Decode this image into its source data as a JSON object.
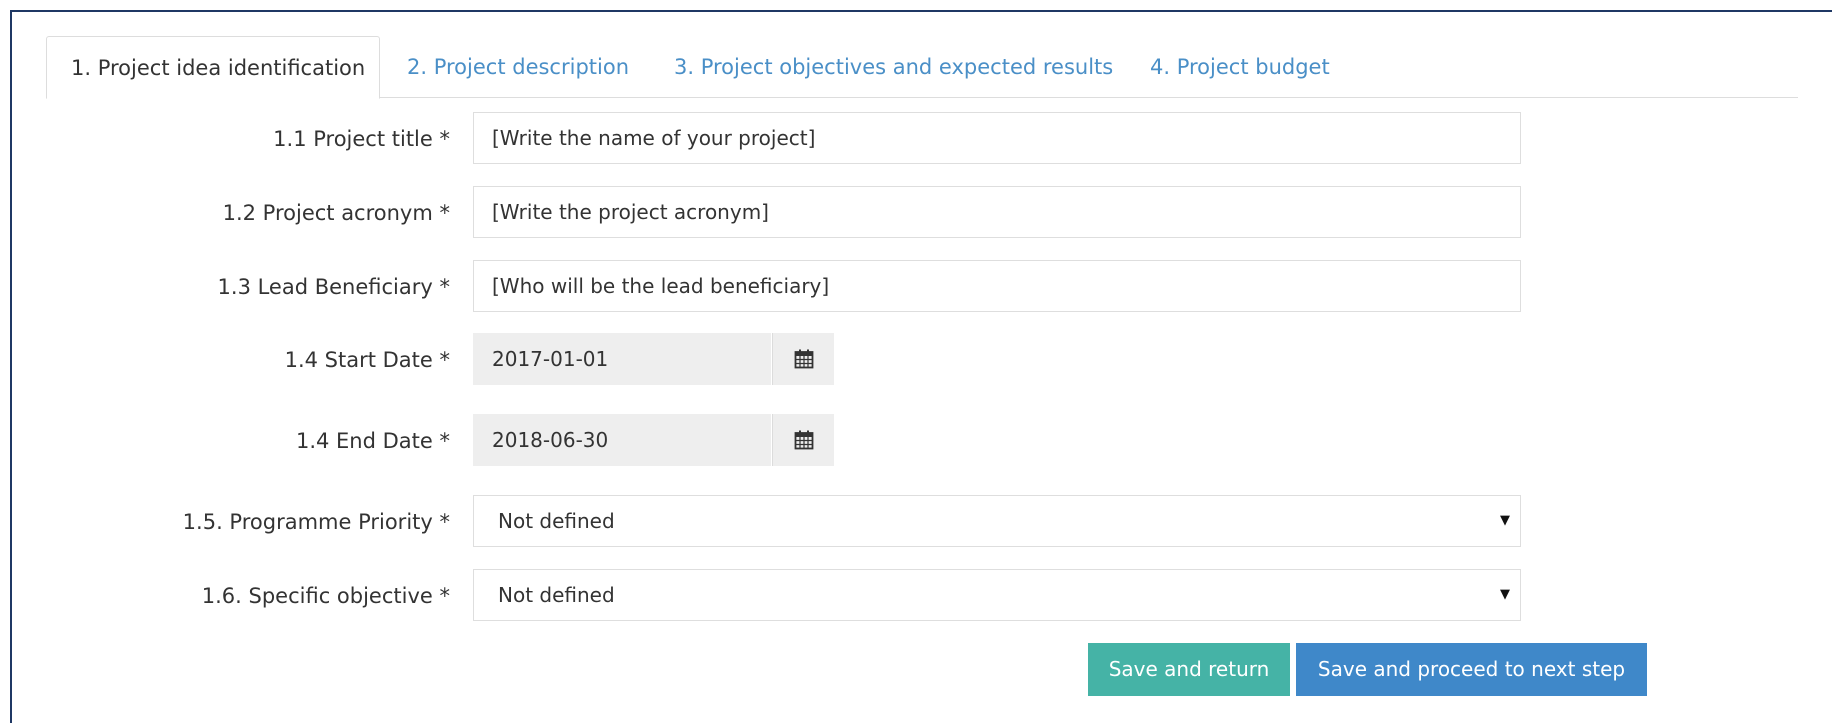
{
  "tabs": [
    {
      "label": "1. Project idea identification",
      "active": true
    },
    {
      "label": "2. Project description",
      "active": false
    },
    {
      "label": "3. Project objectives and expected results",
      "active": false
    },
    {
      "label": "4. Project budget",
      "active": false
    }
  ],
  "form": {
    "project_title": {
      "label": "1.1 Project title *",
      "value": "[Write the name of your project]"
    },
    "project_acronym": {
      "label": "1.2 Project acronym *",
      "value": "[Write the project acronym]"
    },
    "lead_beneficiary": {
      "label": "1.3 Lead Beneficiary *",
      "value": "[Who will be the lead beneficiary]"
    },
    "start_date": {
      "label": "1.4 Start Date *",
      "value": "2017-01-01",
      "icon": "calendar-icon"
    },
    "end_date": {
      "label": "1.4 End Date *",
      "value": "2018-06-30",
      "icon": "calendar-icon"
    },
    "programme_priority": {
      "label": "1.5. Programme Priority *",
      "selected": "Not defined"
    },
    "specific_objective": {
      "label": "1.6. Specific objective *",
      "selected": "Not defined"
    }
  },
  "buttons": {
    "save_return": "Save and return",
    "save_next": "Save and proceed to next step"
  },
  "colors": {
    "frame_border": "#1f3864",
    "tab_link": "#4a8fc7",
    "button_return": "#45b3a6",
    "button_next": "#3f88c9"
  }
}
